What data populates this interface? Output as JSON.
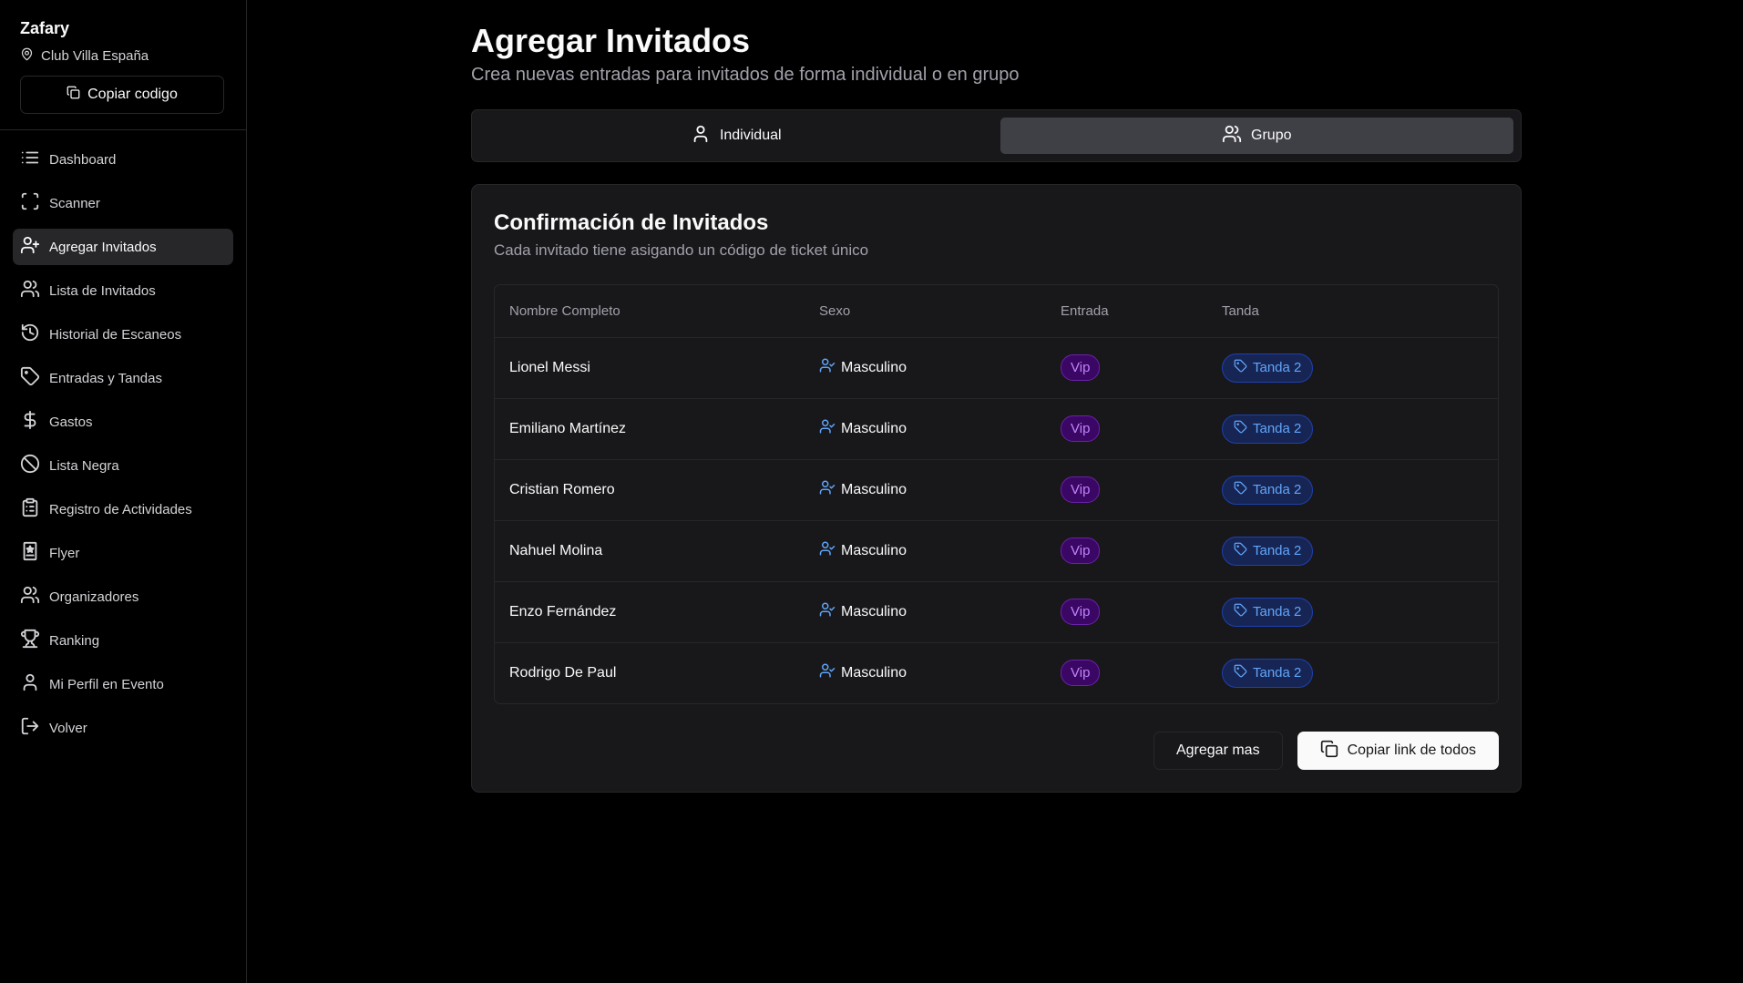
{
  "sidebar": {
    "brand": "Zafary",
    "location": "Club Villa España",
    "copy_code_label": "Copiar codigo",
    "items": [
      {
        "label": "Dashboard",
        "icon": "list-icon"
      },
      {
        "label": "Scanner",
        "icon": "scan-icon"
      },
      {
        "label": "Agregar Invitados",
        "icon": "user-plus-icon",
        "active": true
      },
      {
        "label": "Lista de Invitados",
        "icon": "users-icon"
      },
      {
        "label": "Historial de Escaneos",
        "icon": "history-icon"
      },
      {
        "label": "Entradas y Tandas",
        "icon": "tag-icon"
      },
      {
        "label": "Gastos",
        "icon": "dollar-icon"
      },
      {
        "label": "Lista Negra",
        "icon": "ban-icon"
      },
      {
        "label": "Registro de Actividades",
        "icon": "clipboard-icon"
      },
      {
        "label": "Flyer",
        "icon": "flyer-icon"
      },
      {
        "label": "Organizadores",
        "icon": "users-icon"
      },
      {
        "label": "Ranking",
        "icon": "trophy-icon"
      },
      {
        "label": "Mi Perfil en Evento",
        "icon": "user-icon"
      },
      {
        "label": "Volver",
        "icon": "logout-icon"
      }
    ]
  },
  "header": {
    "title": "Agregar Invitados",
    "subtitle": "Crea nuevas entradas para invitados de forma individual o en grupo"
  },
  "tabs": [
    {
      "label": "Individual",
      "icon": "user-icon",
      "active": false
    },
    {
      "label": "Grupo",
      "icon": "users-icon",
      "active": true
    }
  ],
  "card": {
    "title": "Confirmación de Invitados",
    "description": "Cada invitado tiene asigando un código de ticket único",
    "columns": [
      "Nombre Completo",
      "Sexo",
      "Entrada",
      "Tanda"
    ],
    "rows": [
      {
        "name": "Lionel Messi",
        "sex": "Masculino",
        "entry": "Vip",
        "tanda": "Tanda 2"
      },
      {
        "name": "Emiliano Martínez",
        "sex": "Masculino",
        "entry": "Vip",
        "tanda": "Tanda 2"
      },
      {
        "name": "Cristian Romero",
        "sex": "Masculino",
        "entry": "Vip",
        "tanda": "Tanda 2"
      },
      {
        "name": "Nahuel Molina",
        "sex": "Masculino",
        "entry": "Vip",
        "tanda": "Tanda 2"
      },
      {
        "name": "Enzo Fernández",
        "sex": "Masculino",
        "entry": "Vip",
        "tanda": "Tanda 2"
      },
      {
        "name": "Rodrigo De Paul",
        "sex": "Masculino",
        "entry": "Vip",
        "tanda": "Tanda 2"
      }
    ],
    "add_more_label": "Agregar mas",
    "copy_all_label": "Copiar link de todos"
  },
  "colors": {
    "background": "#000000",
    "panel": "#18181b",
    "border": "#27272a",
    "vip_text": "#c084fc",
    "tanda_text": "#60a5fa",
    "sex_icon": "#60a5fa"
  }
}
